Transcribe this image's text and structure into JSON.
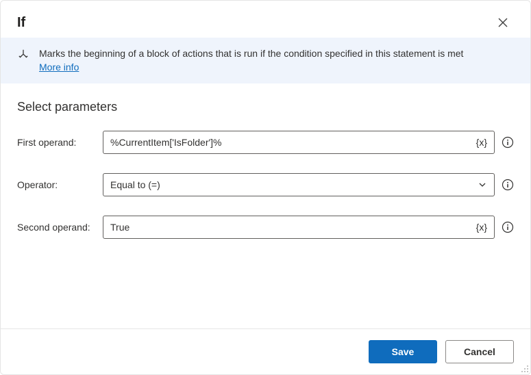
{
  "header": {
    "title": "If"
  },
  "banner": {
    "text": "Marks the beginning of a block of actions that is run if the condition specified in this statement is met",
    "more_info": "More info"
  },
  "section_heading": "Select parameters",
  "params": {
    "first_operand": {
      "label": "First operand:",
      "value": "%CurrentItem['IsFolder']%",
      "variable_token": "{x}"
    },
    "operator": {
      "label": "Operator:",
      "value": "Equal to (=)"
    },
    "second_operand": {
      "label": "Second operand:",
      "value": "True",
      "variable_token": "{x}"
    }
  },
  "footer": {
    "save": "Save",
    "cancel": "Cancel"
  }
}
